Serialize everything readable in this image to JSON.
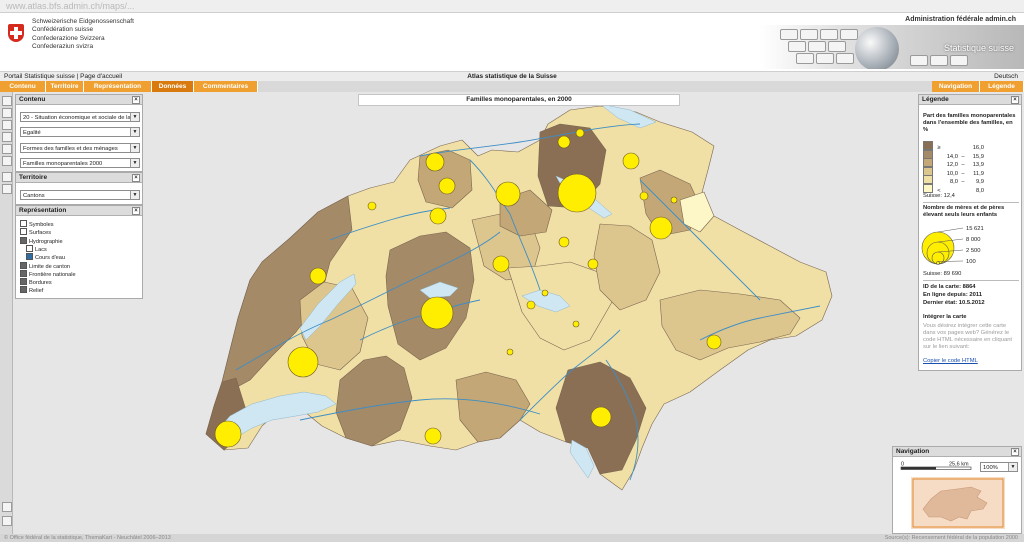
{
  "browser": {
    "url": "www.atlas.bfs.admin.ch/maps/..."
  },
  "header": {
    "confed_lines": [
      "Schweizerische Eidgenossenschaft",
      "Confédération suisse",
      "Confederazione Svizzera",
      "Confederaziun svizra"
    ],
    "admin_link": "Administration fédérale admin.ch",
    "banner_title": "Statistique suisse"
  },
  "nav": {
    "breadcrumb_portal": "Portail Statistique suisse",
    "breadcrumb_home": "Page d'accueil",
    "site_title": "Atlas statistique de la Suisse",
    "language": "Deutsch"
  },
  "tabs_left": [
    {
      "label": "Contenu",
      "active": false
    },
    {
      "label": "Territoire",
      "active": false
    },
    {
      "label": "Représentation",
      "active": false
    },
    {
      "label": "Données",
      "active": true
    },
    {
      "label": "Commentaires",
      "active": false
    }
  ],
  "tabs_right": [
    {
      "label": "Navigation"
    },
    {
      "label": "Légende"
    }
  ],
  "contenu_panel": {
    "title": "Contenu",
    "selects": [
      "20 - Situation économique et sociale de la",
      "Egalité",
      "Formes des familles et des ménages",
      "Familles monoparentales 2000"
    ]
  },
  "territoire_panel": {
    "title": "Territoire",
    "select": "Cantons"
  },
  "representation_panel": {
    "title": "Représentation",
    "layers": [
      {
        "label": "Symboles",
        "checked": false,
        "indent": false,
        "color": "#ffffff"
      },
      {
        "label": "Surfaces",
        "checked": false,
        "indent": false,
        "color": "#ffffff"
      },
      {
        "label": "Hydrographie",
        "checked": true,
        "indent": false,
        "color": "#666666"
      },
      {
        "label": "Lacs",
        "checked": false,
        "indent": true,
        "color": "#ffffff"
      },
      {
        "label": "Cours d'eau",
        "checked": true,
        "indent": true,
        "color": "#2e6ea6"
      },
      {
        "label": "Limite de canton",
        "checked": true,
        "indent": false,
        "color": "#666666"
      },
      {
        "label": "Frontière nationale",
        "checked": true,
        "indent": false,
        "color": "#666666"
      },
      {
        "label": "Bordures",
        "checked": true,
        "indent": false,
        "color": "#666666"
      },
      {
        "label": "Relief",
        "checked": true,
        "indent": false,
        "color": "#666666"
      }
    ]
  },
  "map": {
    "title": "Familles monoparentales, en 2000",
    "lake_color": "#cfe7f3",
    "river_color": "#3d8ec5",
    "circle_color": "#ffee00"
  },
  "legend": {
    "title": "Légende",
    "choropleth_title": "Part des familles monoparentales dans l'ensemble des familles, en %",
    "classes": [
      {
        "op": "≥",
        "low": "",
        "high": "16,0",
        "color": "#8b6f55"
      },
      {
        "op": "",
        "low": "14,0",
        "high": "15,9",
        "color": "#a58a68"
      },
      {
        "op": "",
        "low": "12,0",
        "high": "13,9",
        "color": "#c3a776"
      },
      {
        "op": "",
        "low": "10,0",
        "high": "11,9",
        "color": "#ddc58e"
      },
      {
        "op": "",
        "low": "8,0",
        "high": "9,9",
        "color": "#f0e0a6"
      },
      {
        "op": "<",
        "low": "",
        "high": "8,0",
        "color": "#fdf6c6"
      }
    ],
    "suisse_pct": "Suisse: 12,4",
    "symbols_title": "Nombre de mères et de pères élevant seuls leurs enfants",
    "symbol_values": [
      "15 621",
      "8 000",
      "2 500",
      "100"
    ],
    "suisse_count": "Suisse: 89 690",
    "map_id": "ID de la carte: 8864",
    "online_since": "En ligne depuis: 2011",
    "last_update": "Dernier état: 10.5.2012",
    "integrate_title": "Intégrer la carte",
    "integrate_text": "Vous désirez intégrer cette carte dans vos pages web? Générez le code HTML nécessaire en cliquant sur le lien suivant:",
    "integrate_link": "Copier le code HTML"
  },
  "navigation": {
    "title": "Navigation",
    "scale_zero": "0",
    "scale_label": "25,6 km",
    "zoom": "100%"
  },
  "footer": {
    "left": "© Office fédéral de la statistique, ThemaKart - Neuchâtel 2006–2013",
    "right": "Source(s): Recensement fédéral de la population 2000"
  }
}
